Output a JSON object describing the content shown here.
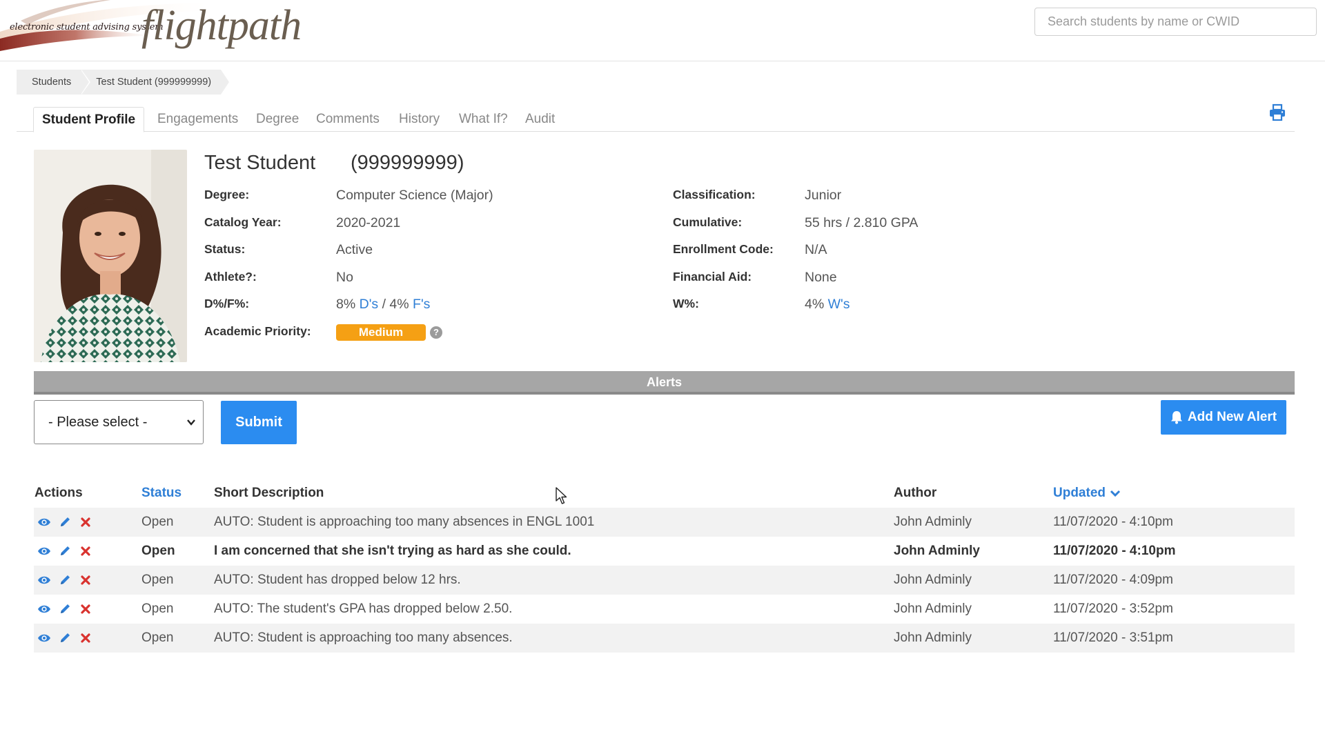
{
  "header": {
    "logo_subtitle": "electronic student advising system",
    "logo_title": "flightpath",
    "search_placeholder": "Search students by name or CWID"
  },
  "breadcrumb": [
    "Students",
    "Test Student (999999999)"
  ],
  "tabs": [
    {
      "label": "Student Profile",
      "active": true
    },
    {
      "label": "Engagements",
      "active": false
    },
    {
      "label": "Degree",
      "active": false
    },
    {
      "label": "Comments",
      "active": false
    },
    {
      "label": "History",
      "active": false
    },
    {
      "label": "What If?",
      "active": false
    },
    {
      "label": "Audit",
      "active": false
    }
  ],
  "icons": {
    "print": "printer-icon",
    "help": "question-circle-icon",
    "view": "eye-icon",
    "edit": "pencil-icon",
    "delete": "x-icon",
    "bell": "bell-icon",
    "sort": "chevron-down-icon"
  },
  "student": {
    "name": "Test Student",
    "id": "(999999999)",
    "left_fields": [
      {
        "label": "Degree:",
        "value": "Computer Science (Major)"
      },
      {
        "label": "Catalog Year:",
        "value": "2020-2021"
      },
      {
        "label": "Status:",
        "value": "Active"
      },
      {
        "label": "Athlete?:",
        "value": "No"
      },
      {
        "label": "D%/F%:",
        "value": "8%",
        "link1": "D's",
        "sep": " / 4%",
        "link2": "F's"
      },
      {
        "label": "Academic Priority:",
        "value": "Medium"
      }
    ],
    "right_fields": [
      {
        "label": "Classification:",
        "value": "Junior"
      },
      {
        "label": "Cumulative:",
        "value": "55 hrs / 2.810 GPA"
      },
      {
        "label": "Enrollment Code:",
        "value": "N/A"
      },
      {
        "label": "Financial Aid:",
        "value": "None"
      },
      {
        "label": "W%:",
        "value": "4%",
        "link1": "W's"
      }
    ],
    "help_symbol": "?"
  },
  "alerts": {
    "title": "Alerts",
    "select_value": "- Please select -",
    "submit_label": "Submit",
    "add_label": "Add New Alert",
    "columns": {
      "actions": "Actions",
      "status": "Status",
      "description": "Short Description",
      "author": "Author",
      "updated": "Updated"
    },
    "rows": [
      {
        "status": "Open",
        "description": "AUTO: Student is approaching too many absences in ENGL 1001",
        "author": "John Adminly",
        "updated": "11/07/2020 - 4:10pm"
      },
      {
        "status": "Open",
        "description": "I am concerned that she isn't trying as hard as she could.",
        "author": "John Adminly",
        "updated": "11/07/2020 - 4:10pm"
      },
      {
        "status": "Open",
        "description": "AUTO: Student has dropped below 12 hrs.",
        "author": "John Adminly",
        "updated": "11/07/2020 - 4:09pm"
      },
      {
        "status": "Open",
        "description": "AUTO: The student's GPA has dropped below 2.50.",
        "author": "John Adminly",
        "updated": "11/07/2020 - 3:52pm"
      },
      {
        "status": "Open",
        "description": "AUTO: Student is approaching too many absences.",
        "author": "John Adminly",
        "updated": "11/07/2020 - 3:51pm"
      }
    ]
  },
  "colors": {
    "accent": "#2b8cf0",
    "link": "#2f7fd6",
    "priority_medium": "#f5a014",
    "delete": "#d9322e"
  }
}
